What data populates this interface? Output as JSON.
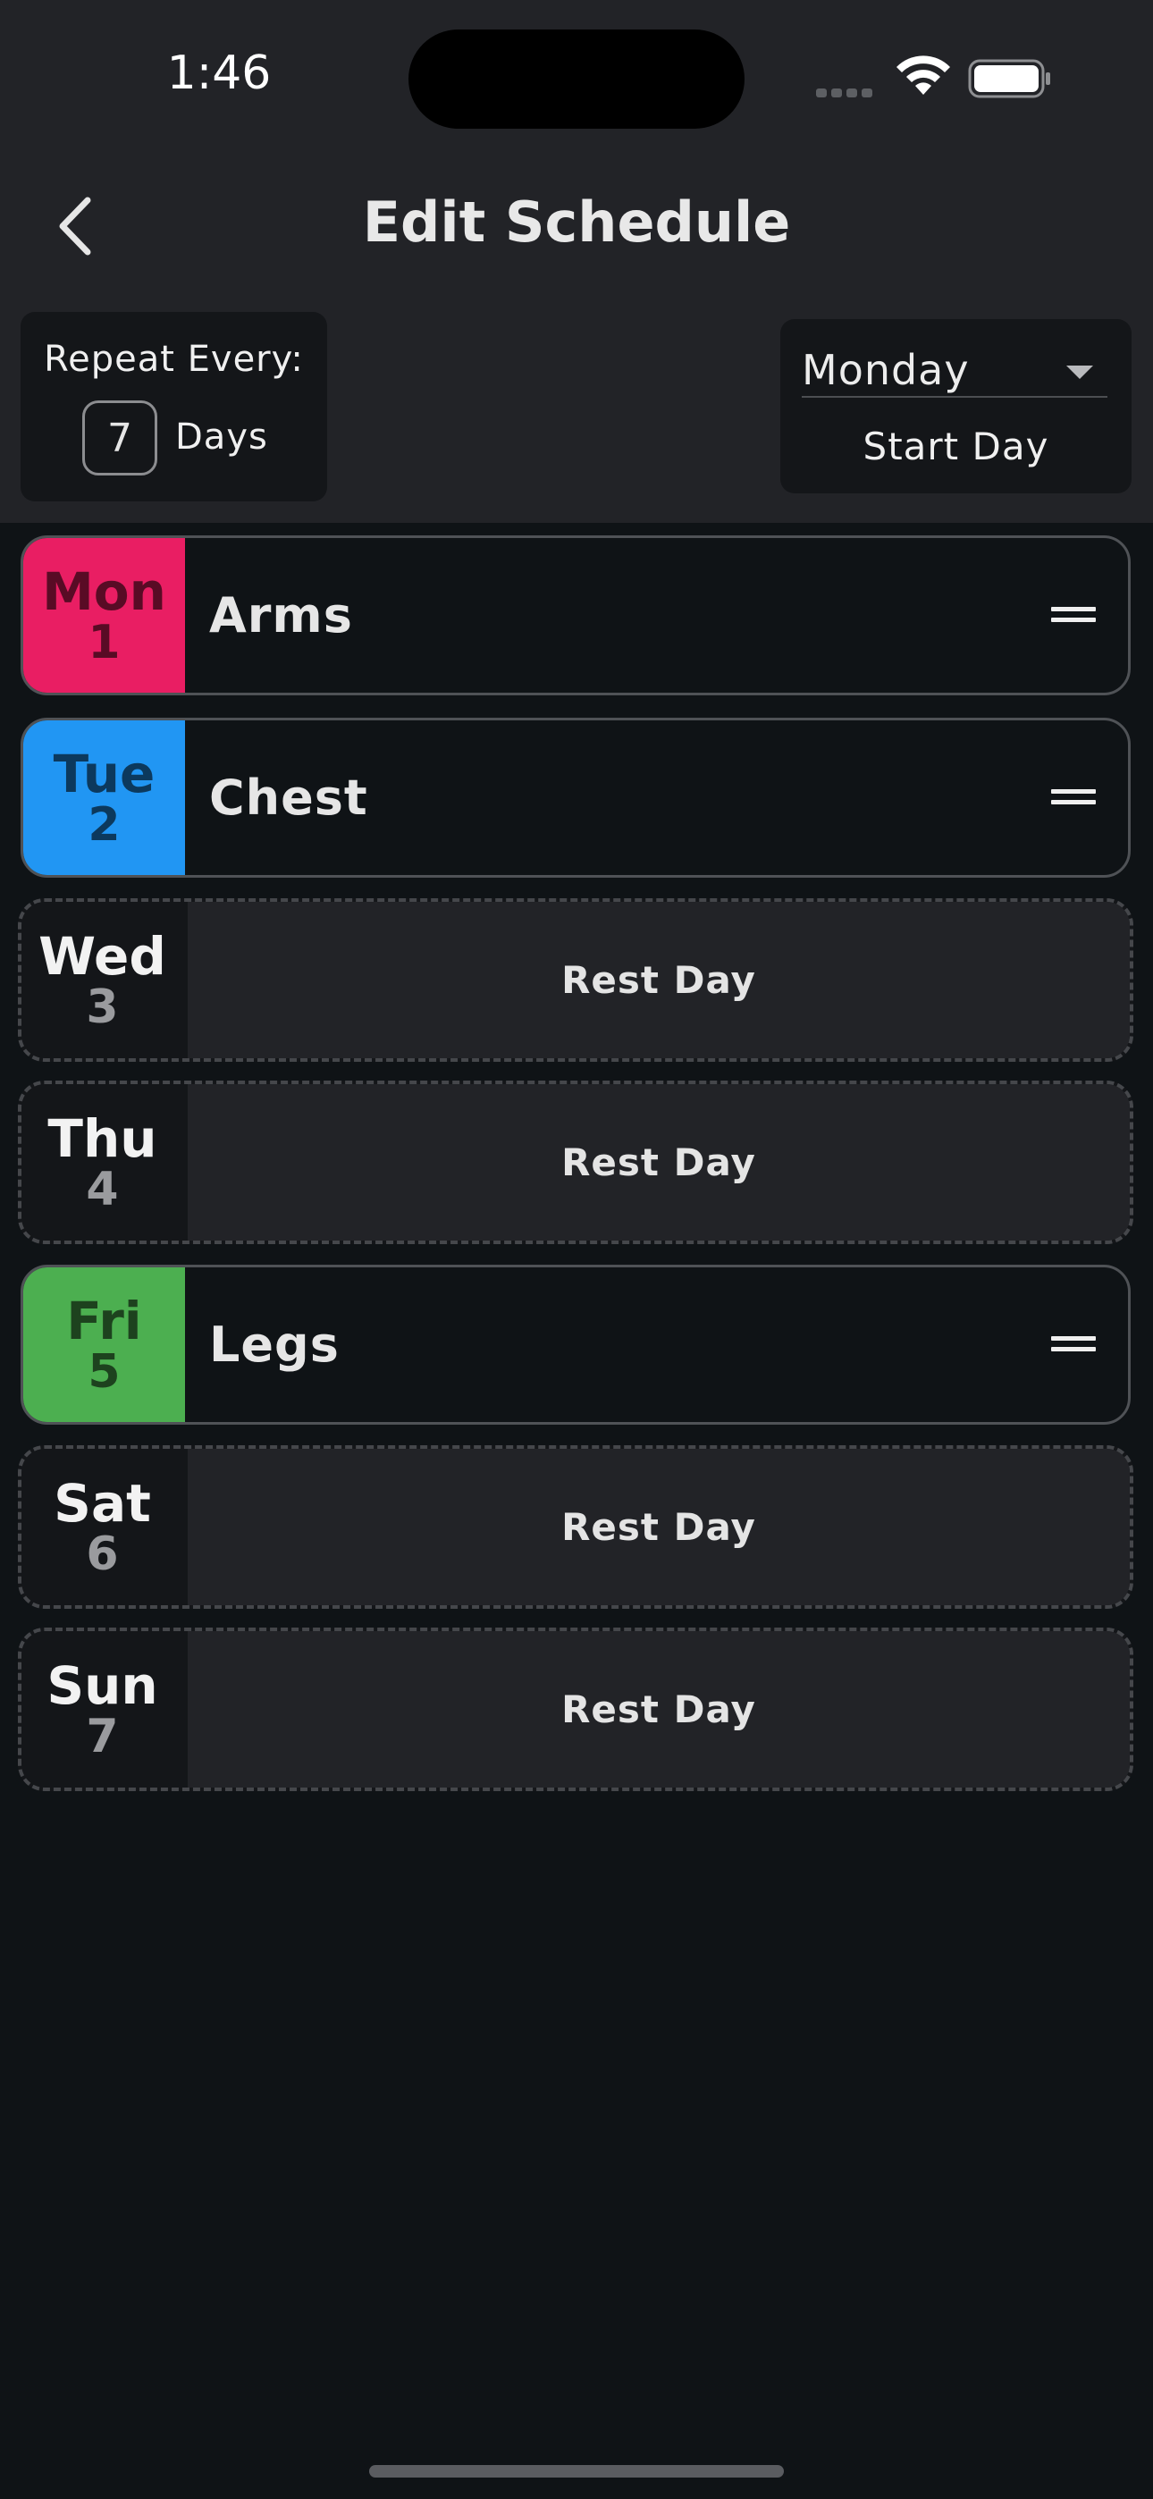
{
  "status_bar": {
    "time": "1:46"
  },
  "header": {
    "title": "Edit Schedule"
  },
  "repeat": {
    "label": "Repeat Every:",
    "value": "7",
    "unit": "Days"
  },
  "start": {
    "value": "Monday",
    "caption": "Start Day"
  },
  "schedule": [
    {
      "day": "Mon",
      "num": "1",
      "workout": "Arms",
      "color": "#e91e63"
    },
    {
      "day": "Tue",
      "num": "2",
      "workout": "Chest",
      "color": "#2196f3"
    },
    {
      "day": "Wed",
      "num": "3",
      "rest": "Rest Day"
    },
    {
      "day": "Thu",
      "num": "4",
      "rest": "Rest Day"
    },
    {
      "day": "Fri",
      "num": "5",
      "workout": "Legs",
      "color": "#4caf50"
    },
    {
      "day": "Sat",
      "num": "6",
      "rest": "Rest Day"
    },
    {
      "day": "Sun",
      "num": "7",
      "rest": "Rest Day"
    }
  ]
}
